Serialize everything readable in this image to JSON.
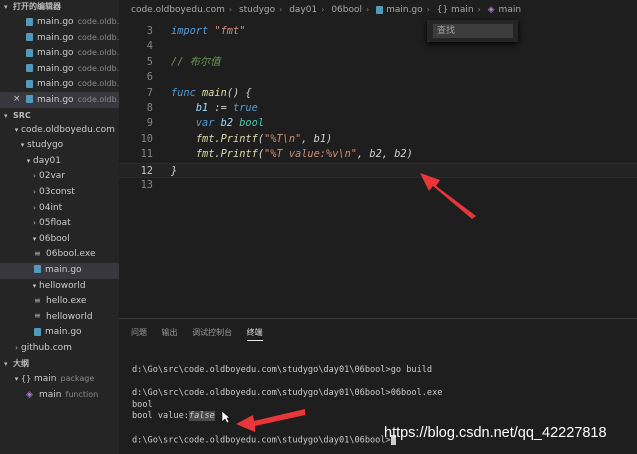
{
  "sidebar": {
    "open_editors": {
      "title": "打开的编辑器",
      "items": [
        {
          "label": "main.go",
          "desc": "code.oldb..."
        },
        {
          "label": "main.go",
          "desc": "code.oldb..."
        },
        {
          "label": "main.go",
          "desc": "code.oldb..."
        },
        {
          "label": "main.go",
          "desc": "code.oldb..."
        },
        {
          "label": "main.go",
          "desc": "code.oldb..."
        },
        {
          "label": "main.go",
          "desc": "code.oldb...",
          "close": "×"
        }
      ]
    },
    "src": {
      "title": "SRC",
      "tree": [
        "code.oldboyedu.com",
        "studygo",
        "day01",
        "02var",
        "03const",
        "04int",
        "05float",
        "06bool",
        "06bool.exe",
        "main.go",
        "helloworld",
        "hello.exe",
        "helloworld",
        "main.go",
        "github.com"
      ]
    },
    "outline": {
      "title": "大纲",
      "items": [
        {
          "label": "main",
          "desc": "package"
        },
        {
          "label": "main",
          "desc": "function"
        }
      ]
    }
  },
  "breadcrumb": [
    "code.oldboyedu.com",
    "studygo",
    "day01",
    "06bool",
    "main.go",
    "{} main",
    "main"
  ],
  "find": {
    "placeholder": "查找"
  },
  "code": {
    "line_numbers": [
      "3",
      "4",
      "5",
      "6",
      "7",
      "8",
      "9",
      "10",
      "11",
      "12",
      "13"
    ],
    "import_kw": "import",
    "import_pkg": "\"fmt\"",
    "comment": "// 布尔值",
    "func_kw": "func",
    "func_name": "main",
    "func_tail": "() {",
    "l8_var": "b1",
    "l8_op": " := ",
    "l8_val": "true",
    "l9_kw": "var",
    "l9_var": "b2",
    "l9_type": "bool",
    "l10_call": "fmt.Printf",
    "l10_open": "(",
    "l10_str": "\"%T\\n\"",
    "l10_tail": ", b1)",
    "l11_call": "fmt.Printf",
    "l11_open": "(",
    "l11_str": "\"%T value:%v\\n\"",
    "l11_tail": ", b2, b2)",
    "l12_close": "}"
  },
  "panel": {
    "tabs": [
      "问题",
      "输出",
      "调试控制台",
      "终端"
    ],
    "active_tab": "终端"
  },
  "terminal": {
    "line1": "d:\\Go\\src\\code.oldboyedu.com\\studygo\\day01\\06bool>go build",
    "line2": "d:\\Go\\src\\code.oldboyedu.com\\studygo\\day01\\06bool>06bool.exe",
    "line3": "bool",
    "line4_prefix": "bool value:",
    "line4_sel": "false",
    "line5": "d:\\Go\\src\\code.oldboyedu.com\\studygo\\day01\\06bool>"
  },
  "watermark": "https://blog.csdn.net/qq_42227818",
  "colors": {
    "arrow": "#e8363a",
    "keyword": "#569cd6",
    "string": "#ce9178",
    "comment": "#6a9955",
    "function": "#dcdcaa",
    "variable": "#9cdcfe"
  }
}
